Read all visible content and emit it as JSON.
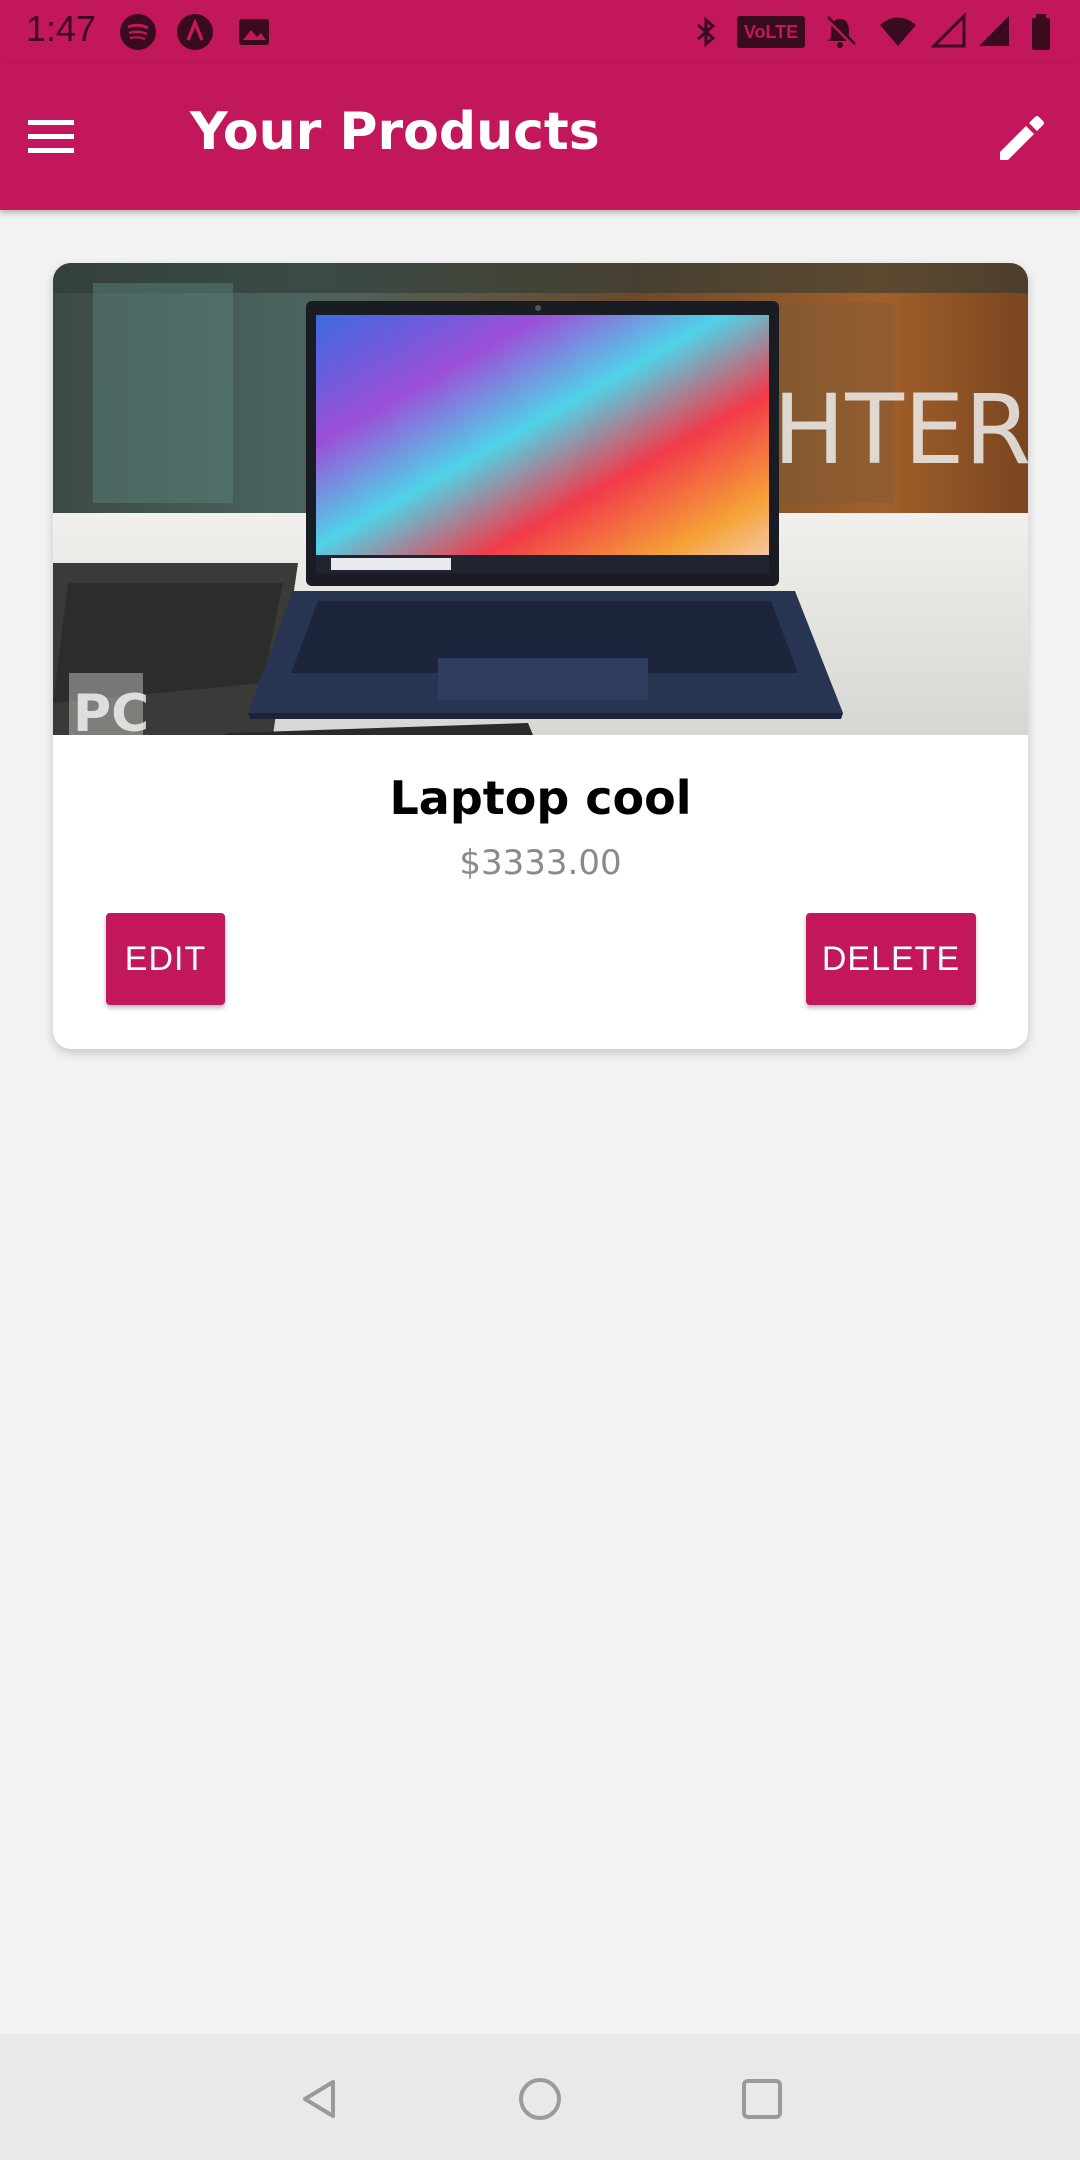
{
  "status_bar": {
    "time": "1:47",
    "icons": [
      "spotify-icon",
      "app-a-icon",
      "image-icon",
      "bluetooth-icon",
      "volte-icon",
      "muted-bell-icon",
      "wifi-icon",
      "signal-empty-icon",
      "signal-icon",
      "battery-icon"
    ],
    "volte_label": "VoLTE"
  },
  "app_bar": {
    "title": "Your Products",
    "menu_icon": "menu-icon",
    "action_icon": "edit-pencil-icon"
  },
  "products": [
    {
      "title": "Laptop cool",
      "price": "$3333.00",
      "image_text": "HTER",
      "watermark": "PC",
      "edit_label": "EDIT",
      "delete_label": "DELETE"
    }
  ],
  "nav_bar": {
    "icons": [
      "back-icon",
      "home-icon",
      "recents-icon"
    ]
  },
  "colors": {
    "primary": "#c2185b",
    "background": "#f2f2f2",
    "card": "#ffffff",
    "price_text": "#8a8a8a"
  }
}
